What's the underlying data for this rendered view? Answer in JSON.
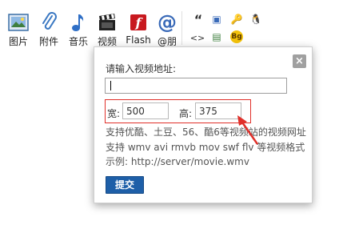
{
  "toolbar": {
    "items": [
      {
        "label": "图片",
        "icon": "image-icon"
      },
      {
        "label": "附件",
        "icon": "paperclip-icon"
      },
      {
        "label": "音乐",
        "icon": "music-note-icon"
      },
      {
        "label": "视频",
        "icon": "clapperboard-icon"
      },
      {
        "label": "Flash",
        "icon": "flash-icon"
      },
      {
        "label": "@朋",
        "icon": "at-icon"
      }
    ],
    "mini_icons": [
      {
        "glyph": "“",
        "name": "quote-icon"
      },
      {
        "glyph": "▣",
        "name": "code-block-icon"
      },
      {
        "glyph": "🔑",
        "name": "key-icon"
      },
      {
        "glyph": "🐧",
        "name": "penguin-icon"
      },
      {
        "glyph": "<>",
        "name": "code-tags-icon"
      },
      {
        "glyph": "▤",
        "name": "image-frame-icon"
      },
      {
        "glyph": "Bg",
        "name": "background-icon"
      }
    ]
  },
  "dialog": {
    "close": "×",
    "prompt": "请输入视频地址:",
    "url_value": "",
    "width_label": "宽:",
    "width_value": "500",
    "height_label": "高:",
    "height_value": "375",
    "info1": "支持优酷、土豆、56、酷6等视频站的视频网址",
    "info2": "支持 wmv avi rmvb mov swf flv 等视频格式",
    "info3": "示例: http://server/movie.wmv",
    "submit": "提交"
  },
  "colors": {
    "accent": "#1e5fa8",
    "highlight_border": "#e0302a"
  }
}
